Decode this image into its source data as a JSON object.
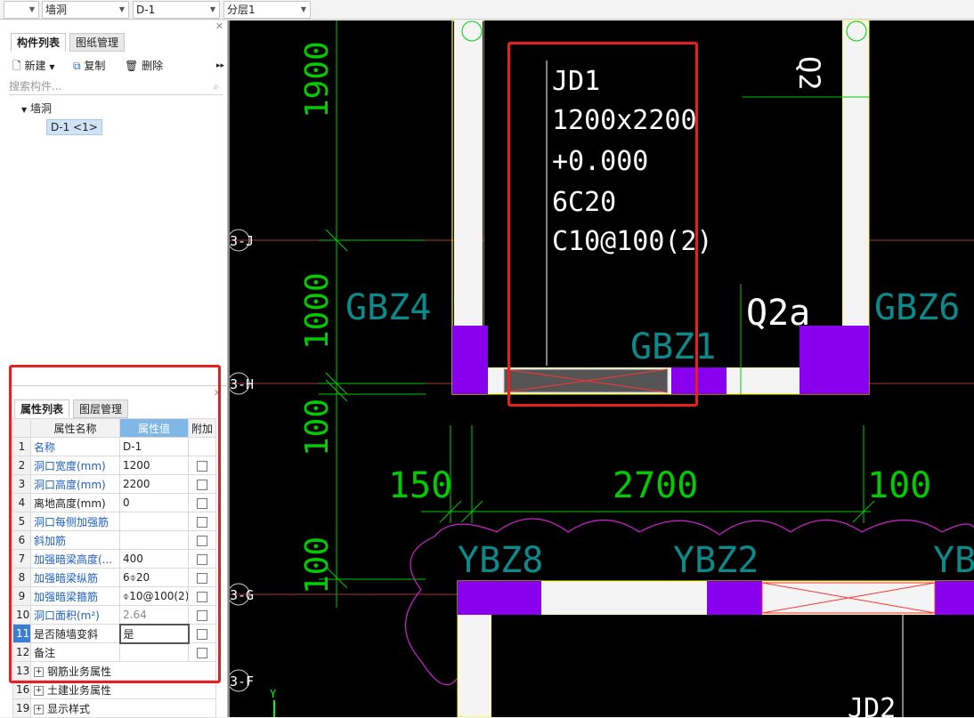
{
  "toolbar": {
    "dropdown1": "",
    "dropdown2": "墙洞",
    "dropdown3": "D-1",
    "dropdown4": "分层1"
  },
  "component_panel": {
    "tabs": [
      "构件列表",
      "图纸管理"
    ],
    "new_label": "新建",
    "copy_label": "复制",
    "delete_label": "删除",
    "search_placeholder": "搜索构件...",
    "tree_root": "墙洞",
    "tree_item": "D-1 <1>"
  },
  "property_panel": {
    "tabs": [
      "属性列表",
      "图层管理"
    ],
    "col_name": "属性名称",
    "col_value": "属性值",
    "col_extra": "附加",
    "rows": [
      {
        "num": "1",
        "name": "名称",
        "value": "D-1"
      },
      {
        "num": "2",
        "name": "洞口宽度(mm)",
        "value": "1200"
      },
      {
        "num": "3",
        "name": "洞口高度(mm)",
        "value": "2200"
      },
      {
        "num": "4",
        "name": "离地高度(mm)",
        "value": "0"
      },
      {
        "num": "5",
        "name": "洞口每侧加强筋",
        "value": ""
      },
      {
        "num": "6",
        "name": "斜加筋",
        "value": ""
      },
      {
        "num": "7",
        "name": "加强暗梁高度(...",
        "value": "400"
      },
      {
        "num": "8",
        "name": "加强暗梁纵筋",
        "value": "6⌽20"
      },
      {
        "num": "9",
        "name": "加强暗梁箍筋",
        "value": "⌽10@100(2)"
      },
      {
        "num": "10",
        "name": "洞口面积(m²)",
        "value": "2.64"
      },
      {
        "num": "11",
        "name": "是否随墙变斜",
        "value": "是"
      },
      {
        "num": "12",
        "name": "备注",
        "value": ""
      }
    ],
    "groups": [
      {
        "num": "13",
        "name": "钢筋业务属性"
      },
      {
        "num": "16",
        "name": "土建业务属性"
      },
      {
        "num": "19",
        "name": "显示样式"
      }
    ]
  },
  "drawing": {
    "opening_text": [
      "JD1",
      "1200x2200",
      "+0.000",
      "6C20",
      "C10@100(2)"
    ],
    "labels": {
      "gbz4": "GBZ4",
      "gbz6": "GBZ6",
      "gbz1": "GBZ1",
      "q2a": "Q2a",
      "q2": "Q2",
      "ybz8": "YBZ8",
      "ybz2": "YBZ2",
      "ybz": "YB",
      "jd2": "JD2"
    },
    "dims": {
      "d1900": "1900",
      "d1000": "1000",
      "d100a": "100",
      "d100b": "100",
      "d150": "150",
      "d2700": "2700",
      "d100c": "100"
    },
    "axes": {
      "j": "3-J",
      "h": "3-H",
      "g": "3-G",
      "f": "3-F"
    },
    "ucs": "Y"
  }
}
